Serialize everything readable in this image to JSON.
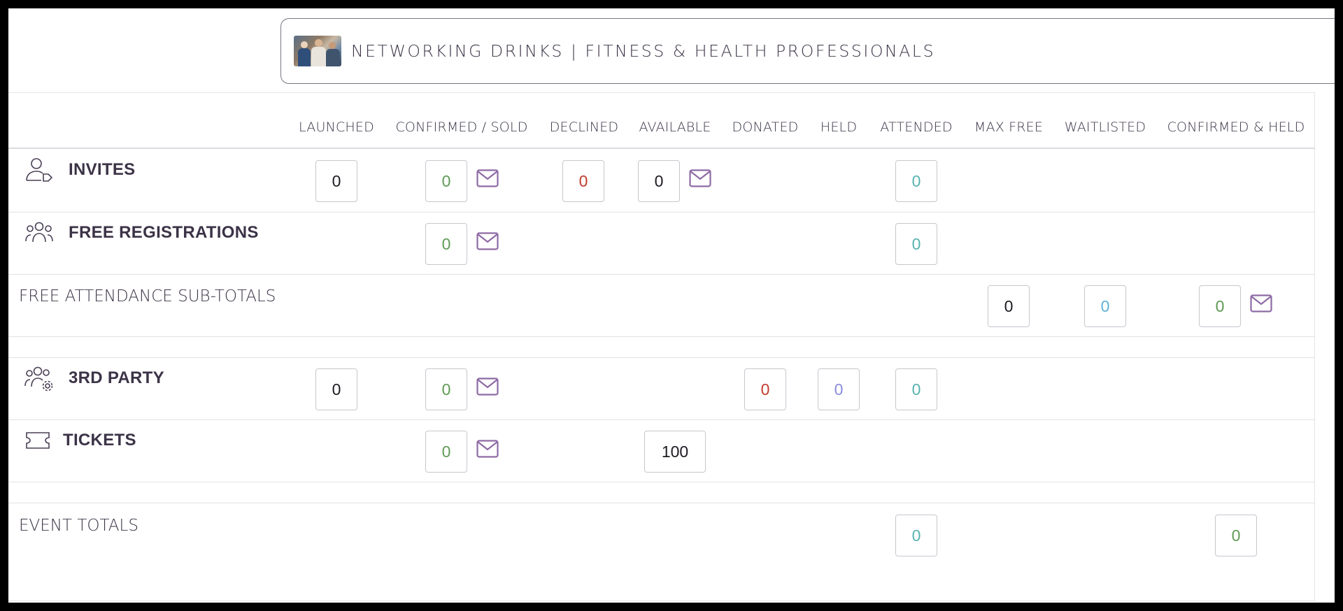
{
  "event": {
    "title": "NETWORKING DRINKS | FITNESS & HEALTH PROFESSIONALS",
    "thumbnail_icon": "event-photo"
  },
  "columns": [
    "LAUNCHED",
    "CONFIRMED / SOLD",
    "DECLINED",
    "AVAILABLE",
    "DONATED",
    "HELD",
    "ATTENDED",
    "MAX FREE",
    "WAITLISTED",
    "CONFIRMED & HELD"
  ],
  "rows": {
    "invites": {
      "label": "INVITES",
      "icon": "user-tag-icon",
      "launched": "0",
      "confirmed": "0",
      "declined": "0",
      "available": "0",
      "attended": "0"
    },
    "free_registrations": {
      "label": "FREE REGISTRATIONS",
      "icon": "users-group-icon",
      "confirmed": "0",
      "attended": "0"
    },
    "free_subtotals": {
      "label": "FREE ATTENDANCE SUB-TOTALS",
      "max_free": "0",
      "waitlisted": "0",
      "confirmed_held": "0"
    },
    "third_party": {
      "label": "3RD PARTY",
      "icon": "users-gear-icon",
      "launched": "0",
      "confirmed": "0",
      "donated": "0",
      "held": "0",
      "attended": "0"
    },
    "tickets": {
      "label": "TICKETS",
      "icon": "ticket-icon",
      "confirmed": "0",
      "available": "100"
    },
    "event_totals": {
      "label": "EVENT TOTALS",
      "attended": "0",
      "confirmed_held": "0"
    }
  },
  "colors": {
    "text": "#3c3347",
    "green": "#5f9b55",
    "red": "#c23b2e",
    "teal": "#58b3b1",
    "blue": "#5fb4d6",
    "lavender": "#8b8ce0",
    "mail": "#8e6aa5"
  }
}
